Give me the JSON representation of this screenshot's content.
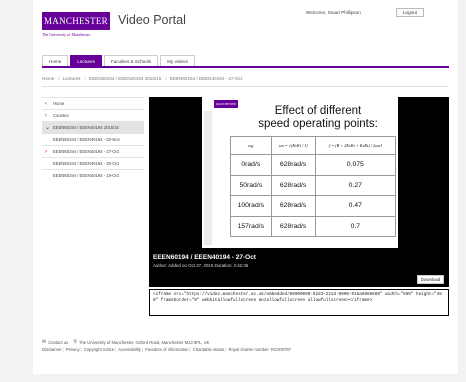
{
  "header": {
    "logo_text": "MANCHESTER",
    "logo_year": "1824",
    "logo_subtitle": "The University of Manchester",
    "portal_title": "Video Portal",
    "welcome": "Welcome, Stuart Phillipson",
    "logout_label": "Logout"
  },
  "tabs": [
    {
      "label": "Home"
    },
    {
      "label": "Lectures"
    },
    {
      "label": "Faculties & Schools"
    },
    {
      "label": "My videos"
    }
  ],
  "breadcrumb": [
    "Home",
    "Lectures",
    "EEEN60194 / EEEN40194 2015/16",
    "EEEN60194 / EEEN40194 - 27-Oct"
  ],
  "sidebar": {
    "items": [
      {
        "label": "Home"
      },
      {
        "label": "Courses"
      },
      {
        "label": "EEEN60194 / EEEN40194 2015/16"
      },
      {
        "label": "EEEN60194 / EEEN40194 - 02-Nov"
      },
      {
        "label": "EEEN60194 / EEEN40194 - 27-Oct"
      },
      {
        "label": "EEEN60194 / EEEN40194 - 20-Oct"
      },
      {
        "label": "EEEN60194 / EEEN40194 - 19-Oct"
      }
    ]
  },
  "slide": {
    "logo": "MANCHESTER",
    "title_line1": "Effect of different",
    "title_line2": "speed operating points:",
    "headers": [
      "ωg",
      "ωn = √(KvKi / J)",
      "ζ = (B + 2KvKt + KvKt) / 2ωnJ"
    ],
    "rows": [
      [
        "0rad/s",
        "628rad/s",
        "0.075"
      ],
      [
        "50rad/s",
        "628rad/s",
        "0.27"
      ],
      [
        "100rad/s",
        "628rad/s",
        "0.47"
      ],
      [
        "157rad/s",
        "628rad/s",
        "0.7"
      ]
    ]
  },
  "video": {
    "title": "EEEN60194 / EEEN40194 - 27-Oct",
    "meta": "Author: Added on Oct 27, 2015 Duration: 2:42:36",
    "download_label": "Download"
  },
  "embed_code": "<iframe src=\"https://video.manchester.ac.uk/embedded/00000000-62d3-221d-0000-015a8868680\" width=\"660\" height=\"380\" frameborder=\"0\" webkitallowfullscreen mozallowfullscreen allowfullscreen></iframe>",
  "footer": {
    "contact": "Contact us",
    "address": "The University of Manchester, Oxford Road, Manchester M13 9PL, UK",
    "links": [
      "Disclaimer",
      "Privacy",
      "Copyright notice",
      "Accessibility",
      "Freedom of information",
      "Charitable status",
      "Royal charter number: RC000797"
    ]
  }
}
